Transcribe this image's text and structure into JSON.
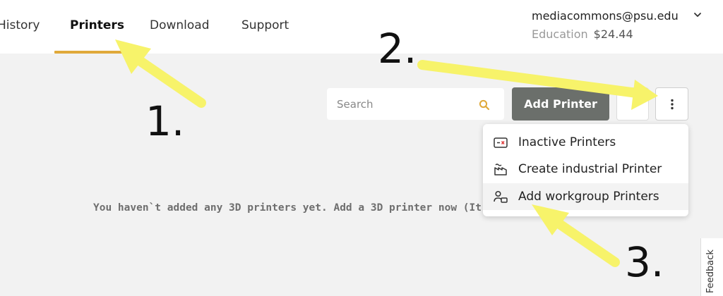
{
  "nav": {
    "tabs": [
      {
        "label": "History"
      },
      {
        "label": "Printers",
        "active": true
      },
      {
        "label": "Download"
      },
      {
        "label": "Support"
      }
    ],
    "active_color": "#e0a93a"
  },
  "account": {
    "email": "mediacommons@psu.edu",
    "plan": "Education",
    "balance": "$24.44"
  },
  "toolbar": {
    "search_placeholder": "Search",
    "add_printer_label": "Add Printer",
    "add_printer_color": "#6b6f6b",
    "more_icon": "kebab-vertical-icon"
  },
  "menu": {
    "items": [
      {
        "label": "Inactive Printers",
        "icon": "inactive-printer-icon"
      },
      {
        "label": "Create industrial Printer",
        "icon": "factory-icon"
      },
      {
        "label": "Add workgroup Printers",
        "icon": "workgroup-icon",
        "highlighted": true
      }
    ]
  },
  "empty_state": {
    "message": "You haven`t added any 3D printers yet. Add a 3D printer now (It"
  },
  "feedback_label": "Feedback",
  "annotations": {
    "step1": "1.",
    "step2": "2.",
    "step3": "3.",
    "arrow_color": "#f7f36a"
  }
}
